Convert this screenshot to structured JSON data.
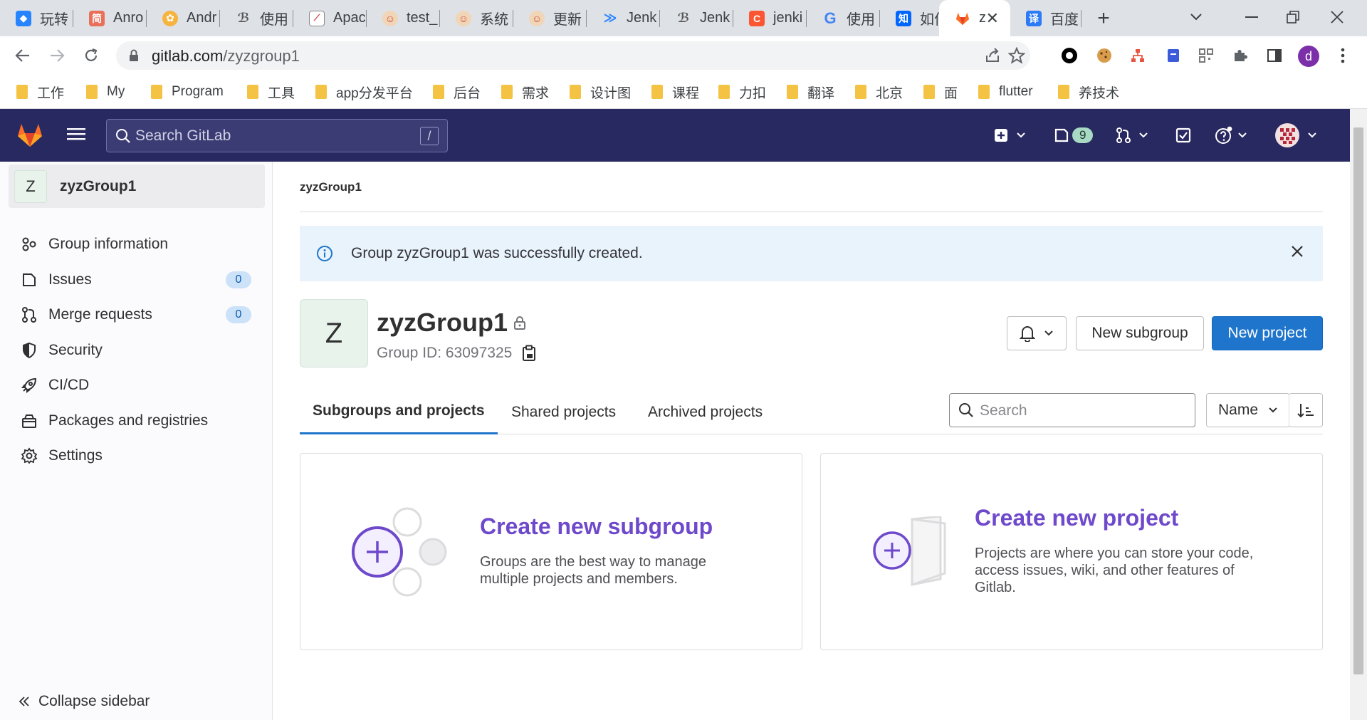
{
  "browser": {
    "tabs": [
      {
        "label": "玩转",
        "icon": "jira-icon",
        "color": "#2684ff"
      },
      {
        "label": "Anro",
        "icon": "jianshu-icon",
        "color": "#ea6f5a"
      },
      {
        "label": "Andr",
        "icon": "juejin-icon",
        "color": "#f6b33d"
      },
      {
        "label": "使用",
        "icon": "jenkins-icon",
        "color": "#555555"
      },
      {
        "label": "Apac",
        "icon": "apache-icon",
        "color": "#888888"
      },
      {
        "label": "test_",
        "icon": "jenkins-butler-icon",
        "color": "#d24939"
      },
      {
        "label": "系统",
        "icon": "jenkins-butler-icon",
        "color": "#d24939"
      },
      {
        "label": "更新",
        "icon": "jenkins-butler-icon",
        "color": "#d24939"
      },
      {
        "label": "Jenk",
        "icon": "jira-icon",
        "color": "#2684ff"
      },
      {
        "label": "Jenk",
        "icon": "jenkins-icon",
        "color": "#555555"
      },
      {
        "label": "jenki",
        "icon": "csdn-icon",
        "color": "#fc5531"
      },
      {
        "label": "使用",
        "icon": "google-icon",
        "color": "#4285f4"
      },
      {
        "label": "如何",
        "icon": "zhihu-icon",
        "color": "#0066ff"
      },
      {
        "label": "z",
        "icon": "gitlab-icon",
        "color": "#fc6d26",
        "active": true
      },
      {
        "label": "百度",
        "icon": "baidu-translate-icon",
        "color": "#2b7bf6"
      }
    ],
    "url_host": "gitlab.com",
    "url_path": "/zyzgroup1",
    "profile_initial": "d",
    "bookmarks": [
      "工作",
      "My",
      "Program",
      "工具",
      "app分发平台",
      "后台",
      "需求",
      "设计图",
      "课程",
      "力扣",
      "翻译",
      "北京",
      "面",
      "flutter",
      "养技术"
    ]
  },
  "header": {
    "search_placeholder": "Search GitLab",
    "search_shortcut": "/",
    "issues_count": "9"
  },
  "sidebar": {
    "avatar_letter": "Z",
    "title": "zyzGroup1",
    "items": [
      {
        "label": "Group information",
        "icon": "group-info-icon"
      },
      {
        "label": "Issues",
        "icon": "issues-icon",
        "count": "0"
      },
      {
        "label": "Merge requests",
        "icon": "merge-request-icon",
        "count": "0"
      },
      {
        "label": "Security",
        "icon": "shield-icon"
      },
      {
        "label": "CI/CD",
        "icon": "rocket-icon"
      },
      {
        "label": "Packages and registries",
        "icon": "package-icon"
      },
      {
        "label": "Settings",
        "icon": "gear-icon"
      }
    ],
    "collapse_label": "Collapse sidebar"
  },
  "main": {
    "breadcrumb": "zyzGroup1",
    "flash_message": "Group zyzGroup1 was successfully created.",
    "group_avatar_letter": "Z",
    "group_name": "zyzGroup1",
    "group_id": "Group ID: 63097325",
    "new_subgroup_label": "New subgroup",
    "new_project_label": "New project",
    "tabs": [
      "Subgroups and projects",
      "Shared projects",
      "Archived projects"
    ],
    "filter_placeholder": "Search",
    "sort_label": "Name",
    "cards": [
      {
        "title": "Create new subgroup",
        "description_lines": [
          "Groups are the best way to manage",
          "multiple projects and members."
        ]
      },
      {
        "title": "Create new project",
        "description_lines": [
          "Projects are where you can store your code,",
          "access issues, wiki, and other features of",
          "Gitlab."
        ]
      }
    ]
  },
  "colors": {
    "header_bg": "#292961",
    "primary": "#1f75cb",
    "card_title": "#6e49cb",
    "flash_bg": "#e9f3fc"
  }
}
